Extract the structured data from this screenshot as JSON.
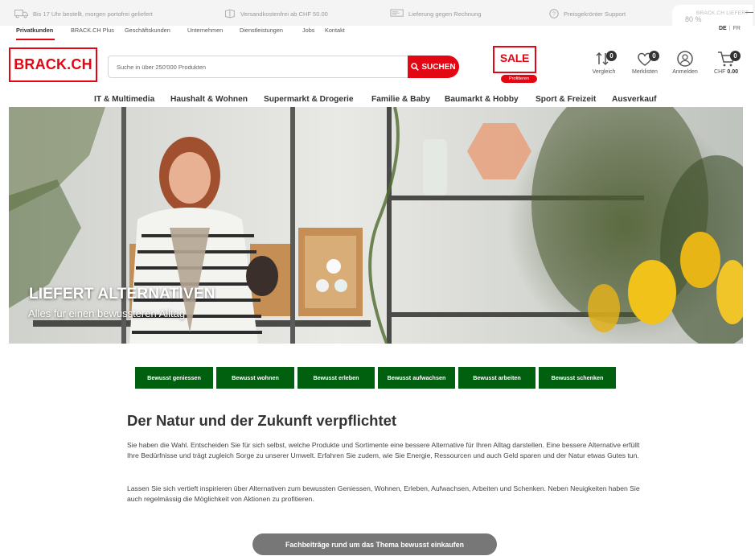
{
  "topbar": {
    "items": [
      {
        "icon": "truck-icon",
        "text": "Bis 17 Uhr bestellt, morgen portofrei geliefert"
      },
      {
        "icon": "gift-box-icon",
        "text": "Versandkostenfrei ab CHF 50.00"
      },
      {
        "icon": "invoice-icon",
        "text": "Lieferung gegen Rechnung"
      },
      {
        "icon": "question-circle-icon",
        "text": "Preisgekrönter Support"
      }
    ],
    "zoom": "80 %",
    "zoom_caption": "BRACK.CH LIEFERT",
    "languages": [
      "DE",
      "FR"
    ]
  },
  "subnav": {
    "items": [
      "Privatkunden",
      "BRACK.CH Plus",
      "Geschäftskunden",
      "Unternehmen",
      "Dienstleistungen",
      "Jobs",
      "Kontakt"
    ],
    "active": "Privatkunden"
  },
  "header": {
    "logo": "BRACK.CH",
    "search_placeholder": "Suche in über 250'000 Produkten",
    "search_button": "SUCHEN",
    "sale_label": "SALE %",
    "sale_badge": "Profitieren",
    "icons": [
      {
        "name": "compare",
        "label": "Vergleich",
        "count": "0"
      },
      {
        "name": "wishlist",
        "label": "Merklisten",
        "count": "0"
      },
      {
        "name": "login",
        "label": "Anmelden"
      },
      {
        "name": "cart",
        "label": "CHF",
        "value": "0.00",
        "count": "0"
      }
    ]
  },
  "categories": [
    "IT & Multimedia",
    "Haushalt & Wohnen",
    "Supermarkt & Drogerie",
    "Familie & Baby",
    "Baumarkt & Hobby",
    "Sport & Freizeit",
    "Ausverkauf"
  ],
  "hero": {
    "title": "LIEFERT ALTERNATIVEN",
    "subtitle": "Alles für einen bewussteren Alltag"
  },
  "theme_buttons": [
    "Bewusst geniessen",
    "Bewusst wohnen",
    "Bewusst erleben",
    "Bewusst aufwachsen",
    "Bewusst arbeiten",
    "Bewusst schenken"
  ],
  "content": {
    "heading": "Der Natur und der Zukunft verpflichtet",
    "paragraph_1": "Sie haben die Wahl. Entscheiden Sie für sich selbst, welche Produkte und Sortimente eine bessere Alternative für Ihren Alltag darstellen. Eine bessere Alternative erfüllt Ihre Bedürfnisse und trägt zugleich Sorge zu unserer Umwelt. Erfahren Sie zudem, wie Sie Energie, Ressourcen und auch Geld sparen und der Natur etwas Gutes tun.",
    "paragraph_2": "Lassen Sie sich vertieft inspirieren über Alternativen zum bewussten Geniessen, Wohnen, Erleben, Aufwachsen, Arbeiten und Schenken. Neben Neuigkeiten haben Sie auch regelmässig die Möglichkeit von Aktionen zu profitieren.",
    "cta": "Fachbeiträge rund um das Thema bewusst einkaufen"
  },
  "colors": {
    "brand_red": "#e30613",
    "theme_green": "#006010",
    "cta_gray": "#777777"
  }
}
